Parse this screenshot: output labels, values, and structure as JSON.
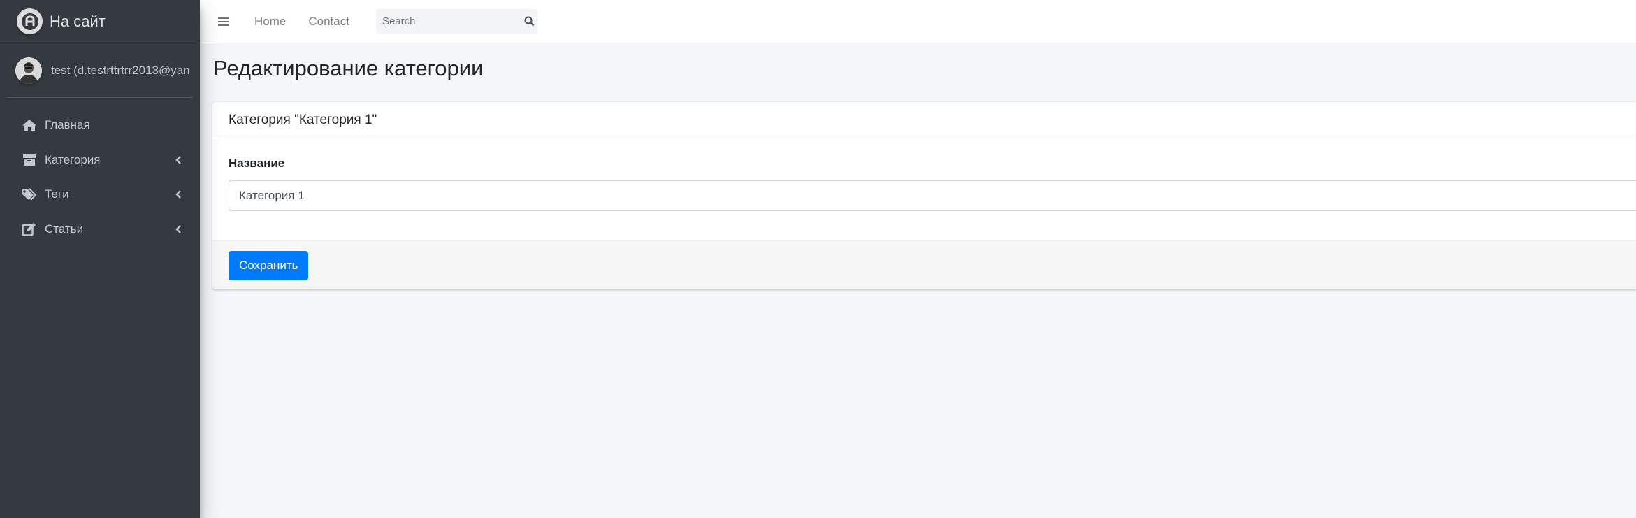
{
  "sidebar": {
    "brand_text": "На сайт",
    "user_name": "test (d.testrttrtrr2013@yan",
    "items": [
      {
        "label": "Главная",
        "icon": "home-icon",
        "has_arrow": false
      },
      {
        "label": "Категория",
        "icon": "archive-icon",
        "has_arrow": true
      },
      {
        "label": "Теги",
        "icon": "tags-icon",
        "has_arrow": true
      },
      {
        "label": "Статьи",
        "icon": "edit-icon",
        "has_arrow": true
      }
    ]
  },
  "navbar": {
    "links": [
      "Home",
      "Contact"
    ],
    "search_placeholder": "Search"
  },
  "page": {
    "title": "Редактирование категории"
  },
  "card": {
    "header": "Категория \"Категория 1\"",
    "field_label": "Название",
    "field_value": "Категория 1",
    "save_label": "Сохранить"
  },
  "colors": {
    "sidebar_bg": "#343a40",
    "content_bg": "#f4f6f9",
    "primary": "#007bff"
  }
}
